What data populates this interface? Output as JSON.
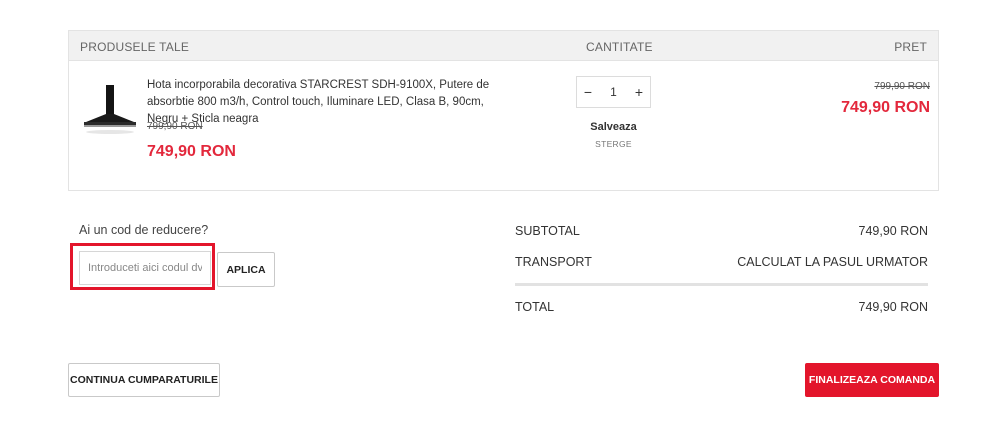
{
  "cart_header": {
    "products": "PRODUSELE TALE",
    "quantity": "CANTITATE",
    "price": "PRET"
  },
  "item": {
    "name": "Hota incorporabila decorativa STARCREST SDH-9100X, Putere de absorbtie 800 m3/h, Control touch, Iluminare LED, Clasa B, 90cm, Negru + Sticla neagra",
    "old_price": "799,90 RON",
    "new_price": "749,90 RON",
    "quantity": "1",
    "decrement": "−",
    "increment": "+",
    "save_label": "Salveaza",
    "delete_label": "STERGE",
    "total_old_price": "799,90 RON",
    "total_new_price": "749,90 RON",
    "image_icon": "range-hood-image"
  },
  "coupon": {
    "title": "Ai un cod de reducere?",
    "placeholder": "Introduceti aici codul dvs",
    "apply_label": "APLICA"
  },
  "summary": {
    "subtotal_label": "SUBTOTAL",
    "subtotal_value": "749,90 RON",
    "transport_label": "TRANSPORT",
    "transport_value": "CALCULAT LA PASUL URMATOR",
    "total_label": "TOTAL",
    "total_value": "749,90 RON"
  },
  "actions": {
    "continue_label": "CONTINUA CUMPARATURILE",
    "checkout_label": "FINALIZEAZA COMANDA"
  },
  "colors": {
    "accent_red": "#e3283c",
    "highlight_red": "#e3152b"
  }
}
